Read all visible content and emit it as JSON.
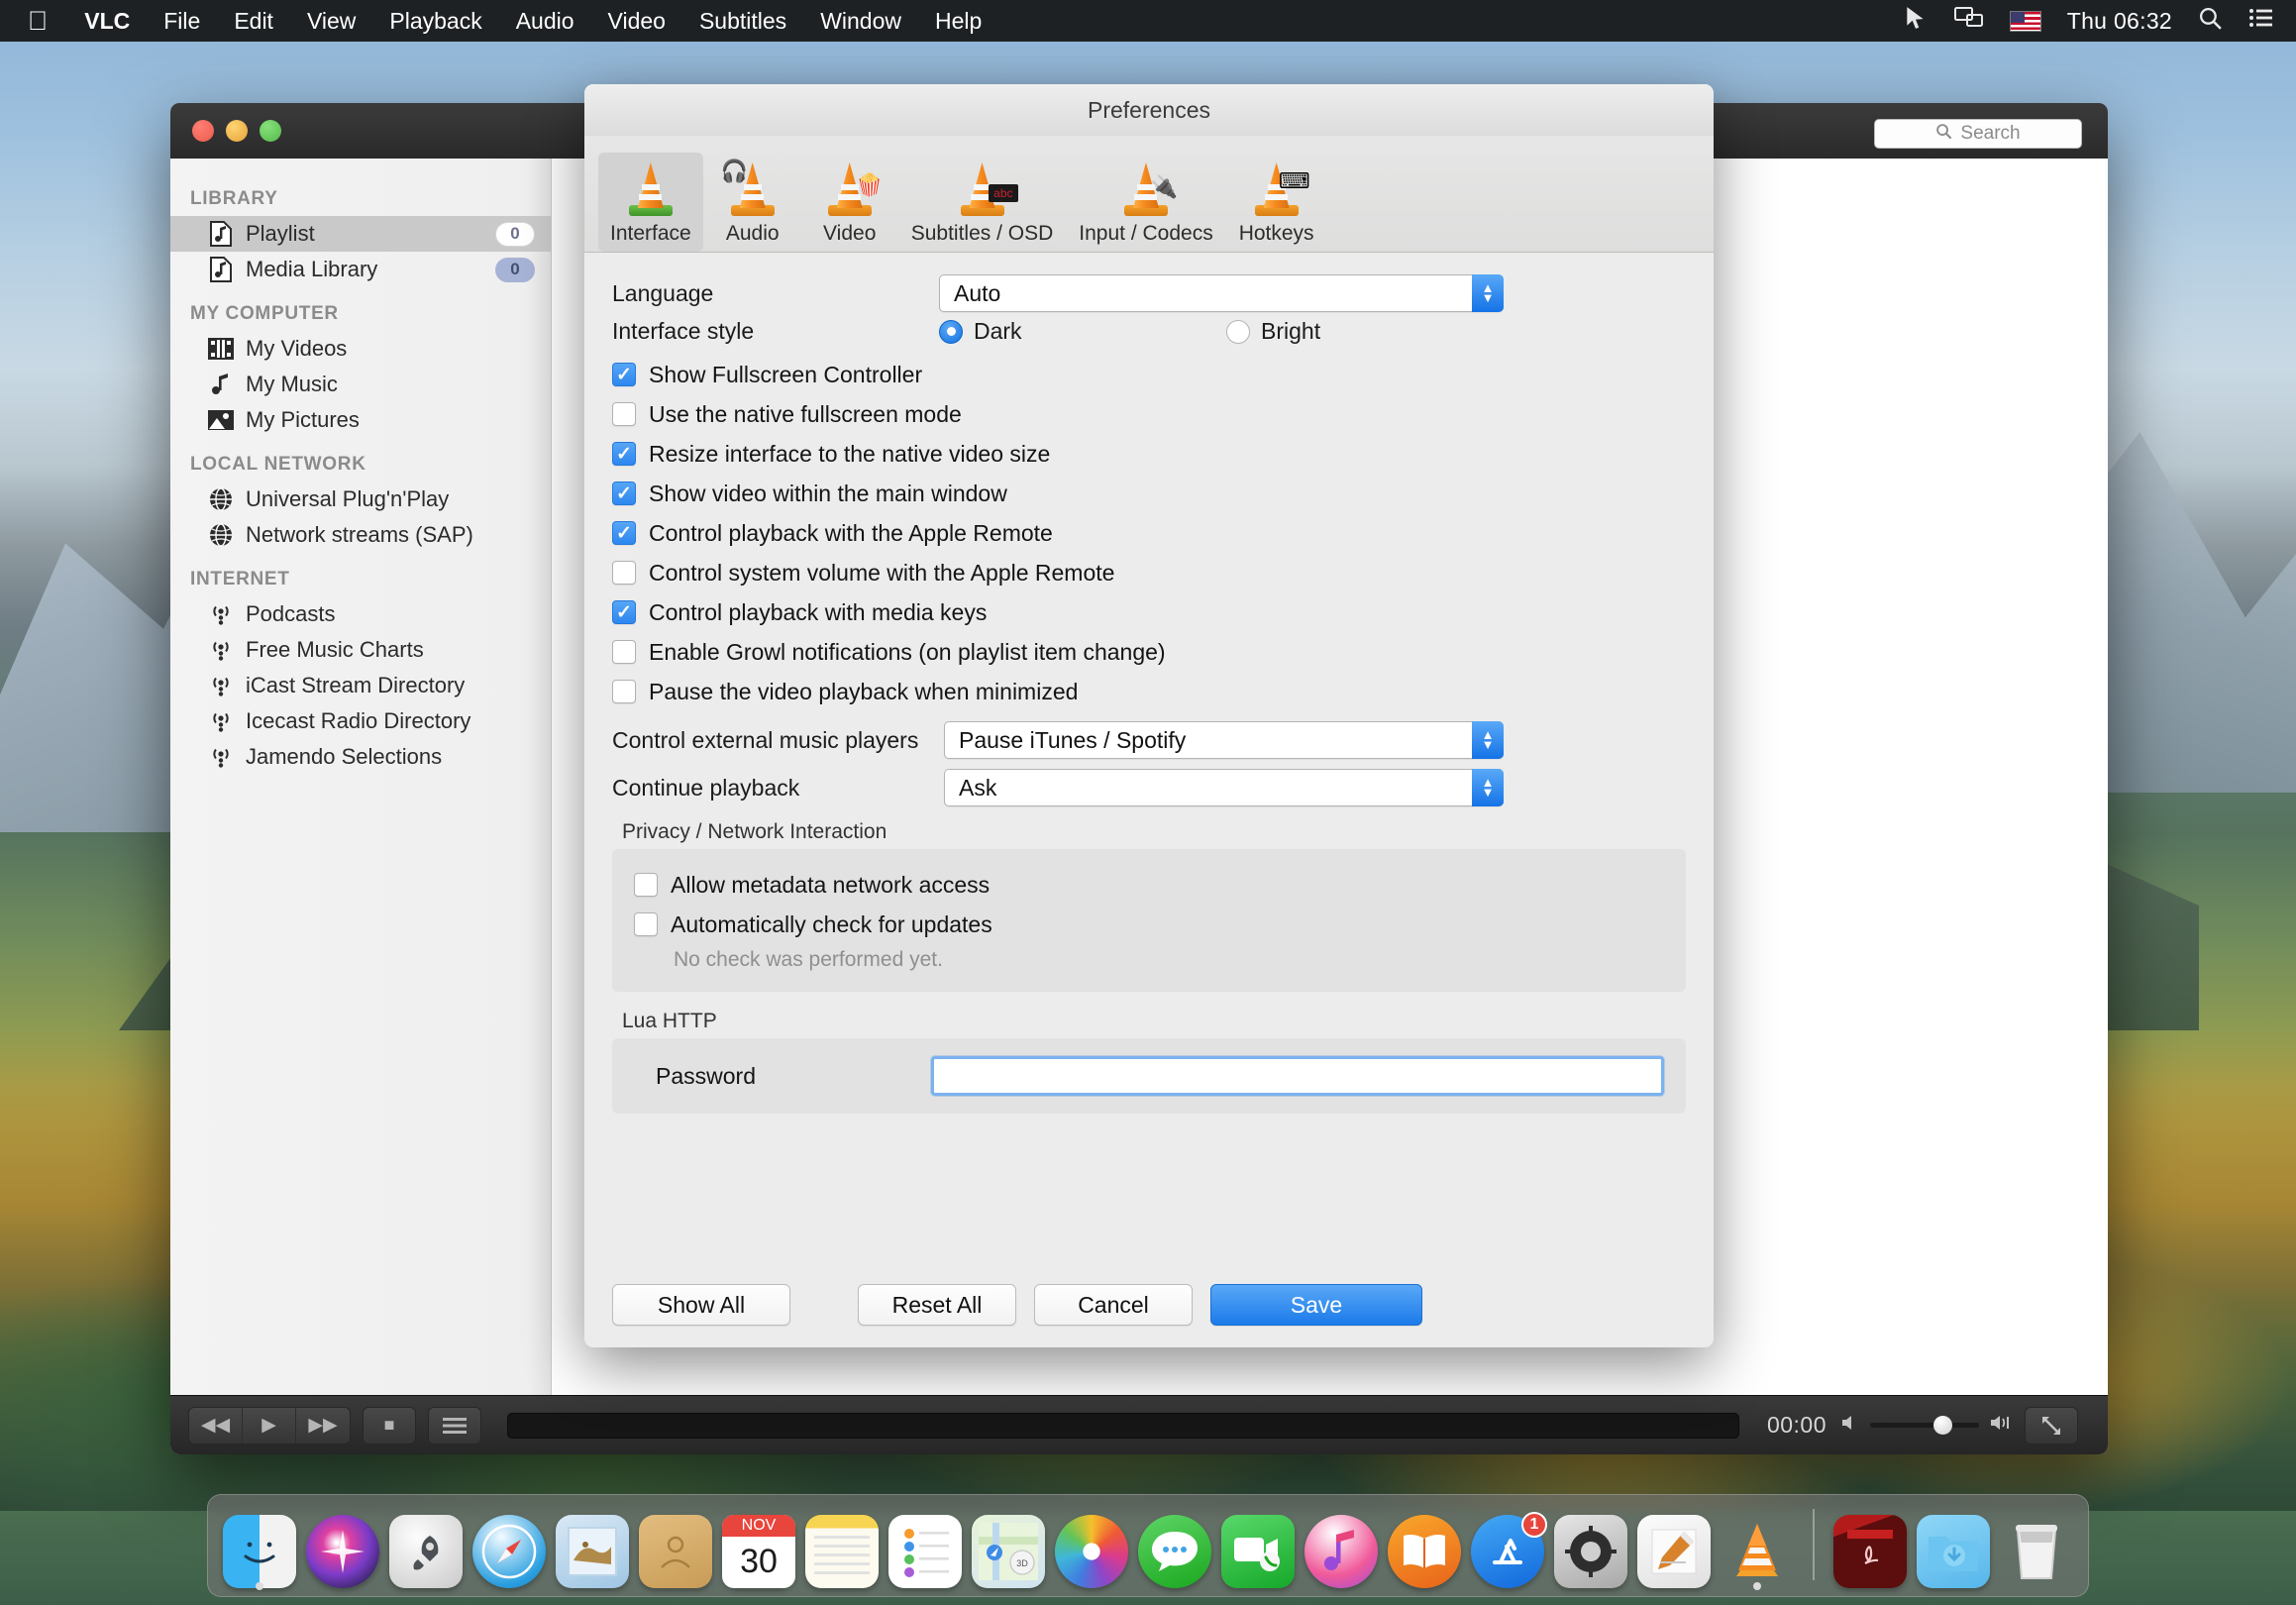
{
  "menubar": {
    "apple_icon": "apple-logo-icon",
    "items": [
      {
        "label": "VLC",
        "bold": true
      },
      {
        "label": "File",
        "bold": false
      },
      {
        "label": "Edit",
        "bold": false
      },
      {
        "label": "View",
        "bold": false
      },
      {
        "label": "Playback",
        "bold": false
      },
      {
        "label": "Audio",
        "bold": false
      },
      {
        "label": "Video",
        "bold": false
      },
      {
        "label": "Subtitles",
        "bold": false
      },
      {
        "label": "Window",
        "bold": false
      },
      {
        "label": "Help",
        "bold": false
      }
    ],
    "status": {
      "cursor_icon": "pointer-capture-icon",
      "display_icon": "screen-mirroring-icon",
      "flag_icon": "us-flag-icon",
      "clock": "Thu 06:32",
      "search_icon": "spotlight-search-icon",
      "control_center_icon": "notification-center-icon"
    }
  },
  "vlc_window": {
    "search_placeholder": "Search",
    "search_icon": "search-icon",
    "sidebar": [
      {
        "type": "header",
        "label": "LIBRARY"
      },
      {
        "type": "item",
        "label": "Playlist",
        "icon": "playlist-file-icon",
        "badge": "0",
        "selected": true,
        "badge_style": "white"
      },
      {
        "type": "item",
        "label": "Media Library",
        "icon": "media-library-file-icon",
        "badge": "0",
        "selected": false,
        "badge_style": "blue"
      },
      {
        "type": "header",
        "label": "MY COMPUTER"
      },
      {
        "type": "item",
        "label": "My Videos",
        "icon": "film-strip-icon",
        "badge": "",
        "selected": false,
        "badge_style": "none"
      },
      {
        "type": "item",
        "label": "My Music",
        "icon": "music-note-icon",
        "badge": "",
        "selected": false,
        "badge_style": "none"
      },
      {
        "type": "item",
        "label": "My Pictures",
        "icon": "picture-icon",
        "badge": "",
        "selected": false,
        "badge_style": "none"
      },
      {
        "type": "header",
        "label": "LOCAL NETWORK"
      },
      {
        "type": "item",
        "label": "Universal Plug'n'Play",
        "icon": "globe-icon",
        "badge": "",
        "selected": false,
        "badge_style": "none"
      },
      {
        "type": "item",
        "label": "Network streams (SAP)",
        "icon": "globe-icon",
        "badge": "",
        "selected": false,
        "badge_style": "none"
      },
      {
        "type": "header",
        "label": "INTERNET"
      },
      {
        "type": "item",
        "label": "Podcasts",
        "icon": "podcast-icon",
        "badge": "",
        "selected": false,
        "badge_style": "none"
      },
      {
        "type": "item",
        "label": "Free Music Charts",
        "icon": "podcast-icon",
        "badge": "",
        "selected": false,
        "badge_style": "none"
      },
      {
        "type": "item",
        "label": "iCast Stream Directory",
        "icon": "podcast-icon",
        "badge": "",
        "selected": false,
        "badge_style": "none"
      },
      {
        "type": "item",
        "label": "Icecast Radio Directory",
        "icon": "podcast-icon",
        "badge": "",
        "selected": false,
        "badge_style": "none"
      },
      {
        "type": "item",
        "label": "Jamendo Selections",
        "icon": "podcast-icon",
        "badge": "",
        "selected": false,
        "badge_style": "none"
      }
    ],
    "controls": {
      "rewind_icon": "rewind-icon",
      "play_icon": "play-icon",
      "forward_icon": "fast-forward-icon",
      "stop_icon": "stop-icon",
      "playlist_icon": "playlist-toggle-icon",
      "time": "00:00",
      "volume_low_icon": "volume-low-icon",
      "volume_high_icon": "volume-high-icon",
      "fullscreen_icon": "fullscreen-icon",
      "volume_percent": 66
    }
  },
  "preferences": {
    "title": "Preferences",
    "toolbar": [
      {
        "label": "Interface",
        "icon": "vlc-cone-interface-icon",
        "active": true
      },
      {
        "label": "Audio",
        "icon": "vlc-cone-headphones-icon",
        "active": false
      },
      {
        "label": "Video",
        "icon": "vlc-cone-popcorn-icon",
        "active": false
      },
      {
        "label": "Subtitles / OSD",
        "icon": "vlc-cone-subtitles-icon",
        "active": false
      },
      {
        "label": "Input / Codecs",
        "icon": "vlc-cone-cables-icon",
        "active": false
      },
      {
        "label": "Hotkeys",
        "icon": "vlc-cone-keys-icon",
        "active": false
      }
    ],
    "language": {
      "label": "Language",
      "value": "Auto"
    },
    "interface_style": {
      "label": "Interface style",
      "options": [
        {
          "label": "Dark",
          "selected": true
        },
        {
          "label": "Bright",
          "selected": false
        }
      ]
    },
    "checkboxes": [
      {
        "label": "Show Fullscreen Controller",
        "checked": true
      },
      {
        "label": "Use the native fullscreen mode",
        "checked": false
      },
      {
        "label": "Resize interface to the native video size",
        "checked": true
      },
      {
        "label": "Show video within the main window",
        "checked": true
      },
      {
        "label": "Control playback with the Apple Remote",
        "checked": true
      },
      {
        "label": "Control system volume with the Apple Remote",
        "checked": false
      },
      {
        "label": "Control playback with media keys",
        "checked": true
      },
      {
        "label": "Enable Growl notifications (on playlist item change)",
        "checked": false
      },
      {
        "label": "Pause the video playback when minimized",
        "checked": false
      }
    ],
    "external_players": {
      "label": "Control external music players",
      "value": "Pause iTunes / Spotify"
    },
    "continue_playback": {
      "label": "Continue playback",
      "value": "Ask"
    },
    "privacy_group": {
      "title": "Privacy / Network Interaction",
      "checkboxes": [
        {
          "label": "Allow metadata network access",
          "checked": false
        },
        {
          "label": "Automatically check for updates",
          "checked": false
        }
      ],
      "note": "No check was performed yet."
    },
    "lua_group": {
      "title": "Lua HTTP",
      "password_label": "Password",
      "password_value": ""
    },
    "buttons": {
      "show_all": "Show All",
      "reset_all": "Reset All",
      "cancel": "Cancel",
      "save": "Save"
    },
    "accent_color": "#1b7ae9"
  },
  "dock": {
    "items": [
      {
        "name": "finder",
        "glyph": "",
        "running": true
      },
      {
        "name": "siri",
        "glyph": "",
        "running": false
      },
      {
        "name": "launchpad",
        "glyph": "🚀",
        "running": false
      },
      {
        "name": "safari",
        "glyph": "🧭",
        "running": false
      },
      {
        "name": "mail",
        "glyph": "",
        "running": false
      },
      {
        "name": "contacts",
        "glyph": "",
        "running": false
      },
      {
        "name": "calendar",
        "glyph": "",
        "running": false,
        "month": "NOV",
        "day": "30"
      },
      {
        "name": "notes",
        "glyph": "",
        "running": false
      },
      {
        "name": "reminders",
        "glyph": "",
        "running": false
      },
      {
        "name": "maps",
        "glyph": "",
        "running": false,
        "label": "3D"
      },
      {
        "name": "photos",
        "glyph": "",
        "running": false
      },
      {
        "name": "messages",
        "glyph": "",
        "running": false
      },
      {
        "name": "facetime",
        "glyph": "",
        "running": false
      },
      {
        "name": "itunes",
        "glyph": "♪",
        "running": false
      },
      {
        "name": "books",
        "glyph": "",
        "running": false
      },
      {
        "name": "app-store",
        "glyph": "A",
        "running": false,
        "badge": "1"
      },
      {
        "name": "system-preferences",
        "glyph": "⚙",
        "running": false
      },
      {
        "name": "textedit",
        "glyph": "",
        "running": false
      },
      {
        "name": "vlc",
        "glyph": "",
        "running": true
      }
    ],
    "trailing": [
      {
        "name": "adobe-acrobat",
        "glyph": ""
      },
      {
        "name": "downloads-folder",
        "glyph": ""
      },
      {
        "name": "trash",
        "glyph": ""
      }
    ]
  }
}
